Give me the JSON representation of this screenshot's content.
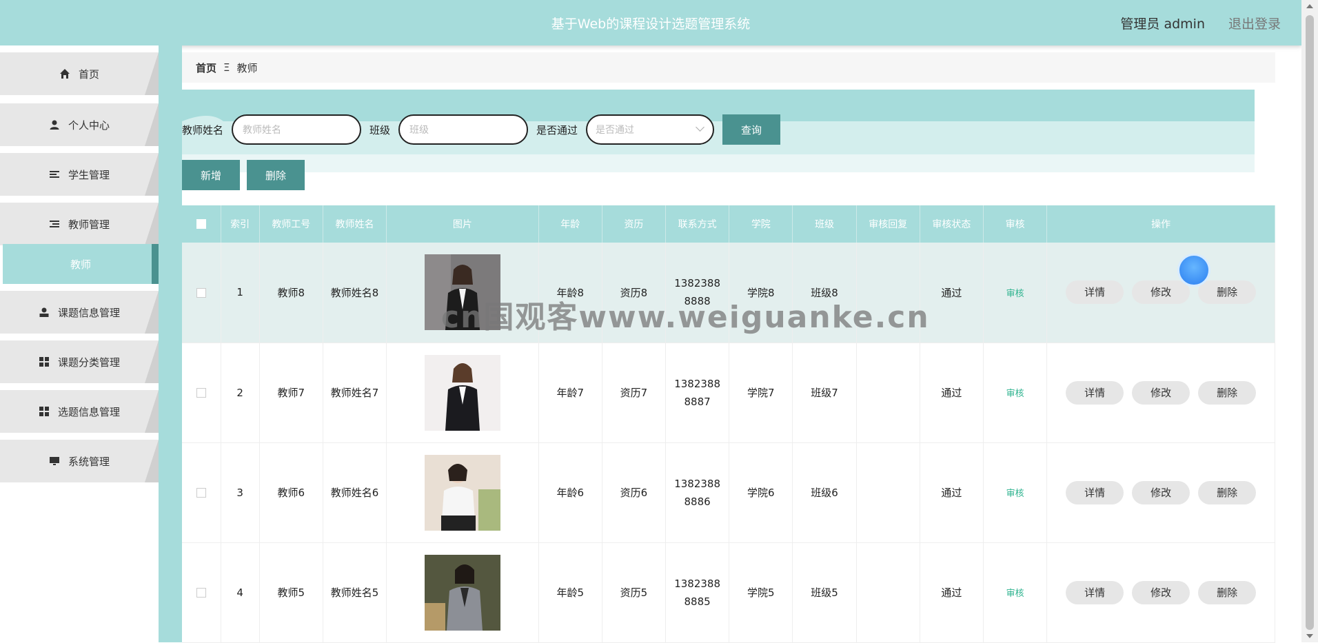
{
  "header": {
    "title": "基于Web的课程设计选题管理系统",
    "user": "管理员 admin",
    "logout": "退出登录"
  },
  "sidebar": {
    "items": [
      {
        "label": "首页",
        "icon": "home-icon"
      },
      {
        "label": "个人中心",
        "icon": "person-icon"
      },
      {
        "label": "学生管理",
        "icon": "list-icon"
      },
      {
        "label": "教师管理",
        "icon": "list-icon"
      },
      {
        "label": "教师",
        "icon": ""
      },
      {
        "label": "课题信息管理",
        "icon": "user-icon"
      },
      {
        "label": "课题分类管理",
        "icon": "grid-icon"
      },
      {
        "label": "选题信息管理",
        "icon": "grid-icon"
      },
      {
        "label": "系统管理",
        "icon": "monitor-icon"
      }
    ]
  },
  "breadcrumb": {
    "home": "首页",
    "sep": "Ξ",
    "current": "教师"
  },
  "search": {
    "name_label": "教师姓名",
    "name_placeholder": "教师姓名",
    "class_label": "班级",
    "class_placeholder": "班级",
    "pass_label": "是否通过",
    "pass_placeholder": "是否通过",
    "query_btn": "查询"
  },
  "actions": {
    "add": "新增",
    "delete": "删除"
  },
  "table": {
    "headers": [
      "索引",
      "教师工号",
      "教师姓名",
      "图片",
      "年龄",
      "资历",
      "联系方式",
      "学院",
      "班级",
      "审核回复",
      "审核状态",
      "审核",
      "操作"
    ],
    "rows": [
      {
        "index": "1",
        "no": "教师8",
        "name": "教师姓名8",
        "age": "年龄8",
        "qual": "资历8",
        "phone": "13823888888",
        "college": "学院8",
        "cls": "班级8",
        "reply": "",
        "status": "通过",
        "audit": "审核"
      },
      {
        "index": "2",
        "no": "教师7",
        "name": "教师姓名7",
        "age": "年龄7",
        "qual": "资历7",
        "phone": "13823888887",
        "college": "学院7",
        "cls": "班级7",
        "reply": "",
        "status": "通过",
        "audit": "审核"
      },
      {
        "index": "3",
        "no": "教师6",
        "name": "教师姓名6",
        "age": "年龄6",
        "qual": "资历6",
        "phone": "13823888886",
        "college": "学院6",
        "cls": "班级6",
        "reply": "",
        "status": "通过",
        "audit": "审核"
      },
      {
        "index": "4",
        "no": "教师5",
        "name": "教师姓名5",
        "age": "年龄5",
        "qual": "资历5",
        "phone": "13823888885",
        "college": "学院5",
        "cls": "班级5",
        "reply": "",
        "status": "通过",
        "audit": "审核"
      }
    ],
    "ops": {
      "detail": "详情",
      "edit": "修改",
      "del": "删除"
    }
  },
  "watermark": "cn国观客www.weiguanke.cn",
  "colors": {
    "accent": "#a6dcdb",
    "button": "#4a9290",
    "audit": "#2fb38f"
  }
}
